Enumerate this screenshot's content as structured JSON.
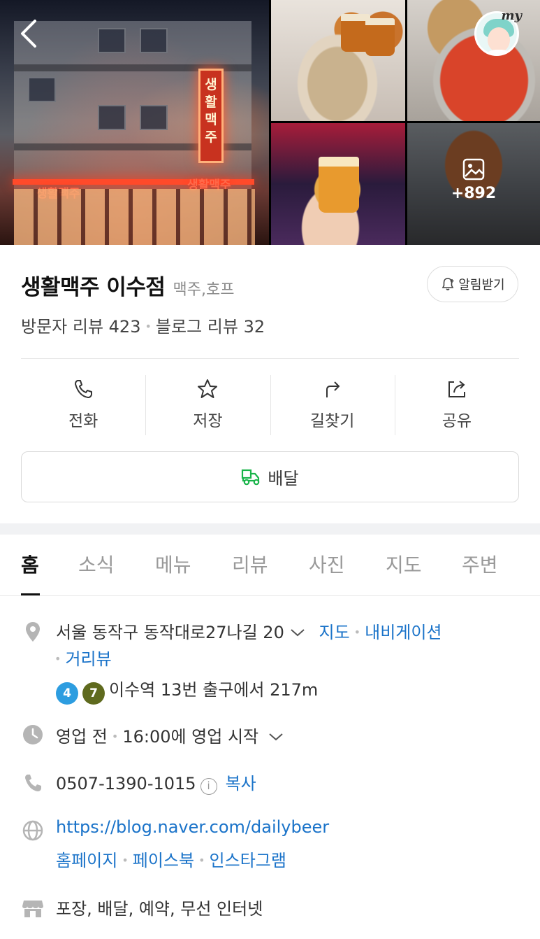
{
  "header": {
    "back_label": "back",
    "my_label": "my",
    "neon_sign_vertical": "생활맥주",
    "neon_sign_left": "생활맥주",
    "neon_sign_right": "생활맥주",
    "more_photos_count": "+892"
  },
  "place": {
    "name": "생활맥주 이수점",
    "category": "맥주,호프",
    "notify_label": "알림받기",
    "visitor_reviews": "방문자 리뷰 423",
    "blog_reviews": "블로그 리뷰 32"
  },
  "actions": [
    {
      "label": "전화",
      "icon": "phone-icon"
    },
    {
      "label": "저장",
      "icon": "star-icon"
    },
    {
      "label": "길찾기",
      "icon": "directions-icon"
    },
    {
      "label": "공유",
      "icon": "share-icon"
    }
  ],
  "delivery": {
    "label": "배달",
    "icon": "delivery-scooter-icon",
    "icon_color": "#19b44a"
  },
  "tabs": [
    "홈",
    "소식",
    "메뉴",
    "리뷰",
    "사진",
    "지도",
    "주변"
  ],
  "info": {
    "address": "서울 동작구 동작대로27나길 20",
    "map_link": "지도",
    "navigation_link": "내비게이션",
    "street_view_link": "거리뷰",
    "subway_lines": [
      {
        "number": "4",
        "color": "#2d9de0"
      },
      {
        "number": "7",
        "color": "#5f6a1e"
      }
    ],
    "subway_text": "이수역 13번 출구에서 217m",
    "hours_status": "영업 전",
    "hours_detail": "16:00에 영업 시작",
    "phone": "0507-1390-1015",
    "copy_label": "복사",
    "website": "https://blog.naver.com/dailybeer",
    "homepage_link": "홈페이지",
    "facebook_link": "페이스북",
    "instagram_link": "인스타그램",
    "amenities": "포장, 배달, 예약, 무선 인터넷"
  },
  "colors": {
    "link": "#1a73c9",
    "accent_green": "#19b44a",
    "divider": "#e6e6e6"
  }
}
